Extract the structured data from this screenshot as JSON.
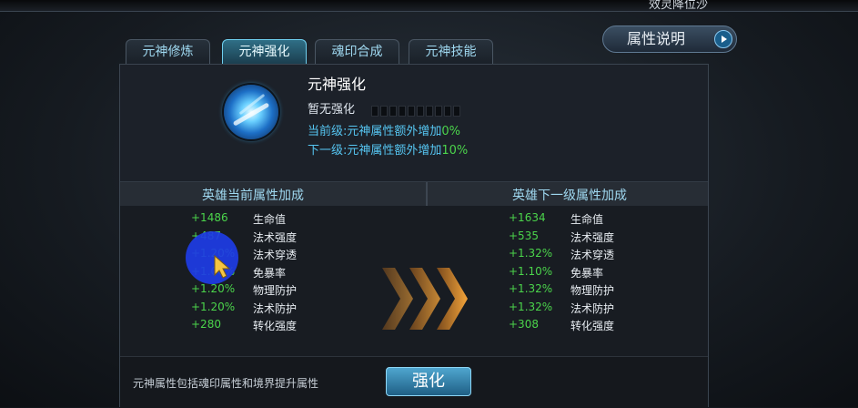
{
  "topbar": {
    "text": "效灵降位沙"
  },
  "tabs": [
    {
      "label": "元神修炼",
      "active": false
    },
    {
      "label": "元神强化",
      "active": true
    },
    {
      "label": "魂印合成",
      "active": false
    },
    {
      "label": "元神技能",
      "active": false
    }
  ],
  "help_button": {
    "label": "属性说明",
    "icon": "play-arrow-icon"
  },
  "info": {
    "title": "元神强化",
    "status": "暂无强化",
    "progress_segments": 10,
    "progress_filled": 0,
    "current_prefix": "当前级:元神属性额外增加",
    "current_value": "0%",
    "next_prefix": "下一级:元神属性额外增加",
    "next_value": "10%",
    "icon": "yuanshen-spirit-icon"
  },
  "current_col": {
    "title": "英雄当前属性加成",
    "stats": [
      {
        "value": "+1486",
        "name": "生命值"
      },
      {
        "value": "+487",
        "name": "法术强度"
      },
      {
        "value": "+1.20%",
        "name": "法术穿透"
      },
      {
        "value": "+1.00%",
        "name": "免暴率"
      },
      {
        "value": "+1.20%",
        "name": "物理防护"
      },
      {
        "value": "+1.20%",
        "name": "法术防护"
      },
      {
        "value": "+280",
        "name": "转化强度"
      }
    ]
  },
  "next_col": {
    "title": "英雄下一级属性加成",
    "stats": [
      {
        "value": "+1634",
        "name": "生命值"
      },
      {
        "value": "+535",
        "name": "法术强度"
      },
      {
        "value": "+1.32%",
        "name": "法术穿透"
      },
      {
        "value": "+1.10%",
        "name": "免暴率"
      },
      {
        "value": "+1.32%",
        "name": "物理防护"
      },
      {
        "value": "+1.32%",
        "name": "法术防护"
      },
      {
        "value": "+308",
        "name": "转化强度"
      }
    ]
  },
  "footer": {
    "note": "元神属性包括魂印属性和境界提升属性",
    "enhance_label": "强化"
  },
  "colors": {
    "accent_blue": "#56c6f2",
    "stat_green": "#4bd44b",
    "arrow_orange": "#f2a33a",
    "cursor_blue": "#1e3ce6"
  }
}
